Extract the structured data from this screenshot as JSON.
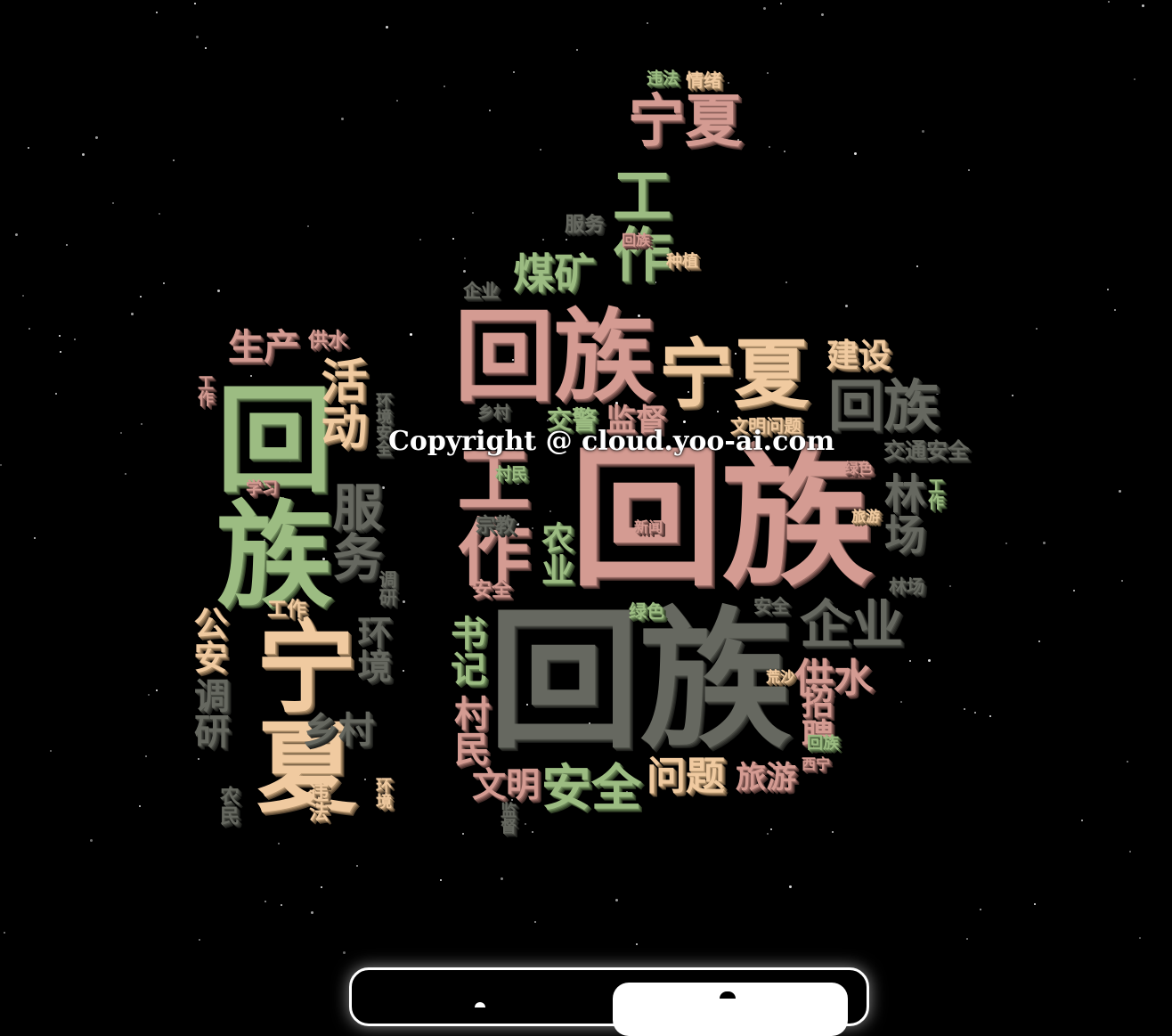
{
  "watermark": "Copyright @ cloud.yoo-ai.com",
  "palette": {
    "pink": "#d49b92",
    "green": "#9cbc82",
    "tan": "#f0caa0",
    "grey": "#666860",
    "background": "#000000"
  },
  "words": {
    "w01": "回族",
    "w02": "回族",
    "w03": "回族",
    "w04": "回族",
    "w05": "回族",
    "w06": "宁夏",
    "w07": "宁夏",
    "w08": "宁夏",
    "w09": "工作",
    "w10": "工作",
    "w11": "活动",
    "w12": "服务",
    "w13": "煤矿",
    "w14": "监督",
    "w15": "建设",
    "w16": "企业",
    "w17": "供水",
    "w18": "安全",
    "w19": "问题",
    "w20": "旅游",
    "w21": "农业",
    "w22": "书记",
    "w23": "村民",
    "w24": "文明",
    "w25": "乡村",
    "w26": "环境",
    "w27": "公安",
    "w28": "调研",
    "w29": "招聘",
    "w30": "林场",
    "w31": "交通安全",
    "w32": "生产",
    "w33": "供水",
    "w34": "违法",
    "w35": "情绪",
    "w36": "服务",
    "w37": "种植",
    "w38": "企业",
    "w39": "乡村",
    "w40": "学习",
    "w41": "工作",
    "w42": "宗教",
    "w43": "安全",
    "w44": "文明问题",
    "w45": "绿色",
    "w46": "旅游",
    "w47": "林场",
    "w48": "绿色",
    "w49": "安全",
    "w50": "荒沙",
    "w51": "回族",
    "w52": "西宁",
    "w53": "违法",
    "w54": "监督",
    "w55": "工作",
    "w56": "环境",
    "w57": "交警",
    "w58": "环境安全",
    "w59": "回族",
    "w60": "新闻",
    "w61": "调研",
    "w62": "村民",
    "w63": "工作",
    "w64": "农民"
  }
}
